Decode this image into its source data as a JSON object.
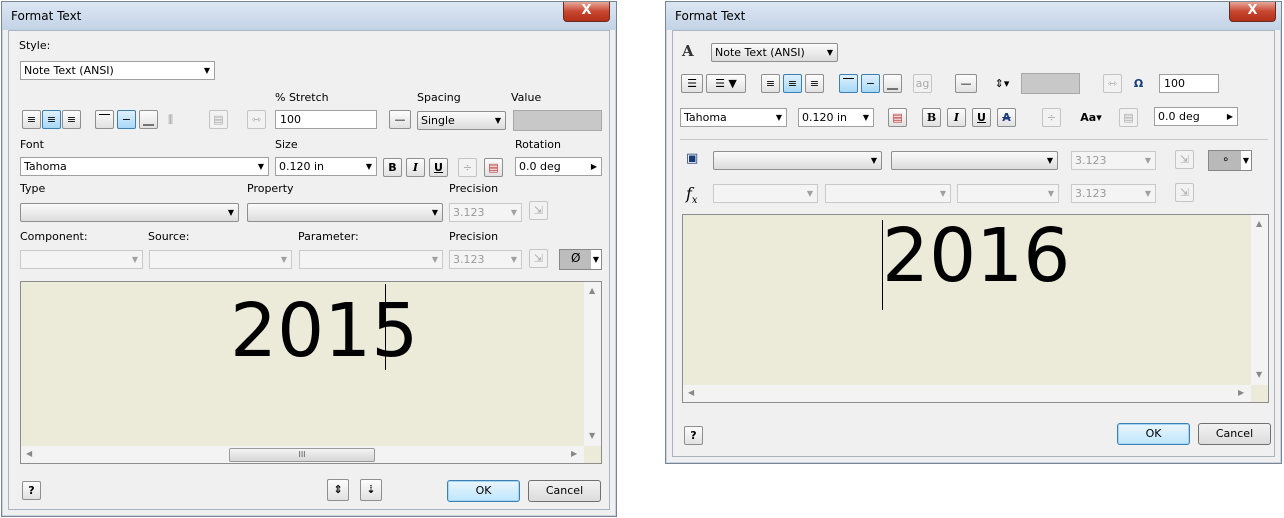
{
  "left_dialog": {
    "title": "Format Text",
    "close_glyph": "X",
    "style_label": "Style:",
    "style_value": "Note Text (ANSI)",
    "stretch_label": "% Stretch",
    "stretch_value": "100",
    "spacing_label": "Spacing",
    "spacing_value": "Single",
    "value_label": "Value",
    "font_label": "Font",
    "font_value": "Tahoma",
    "size_label": "Size",
    "size_value": "0.120 in",
    "rotation_label": "Rotation",
    "rotation_value": "0.0 deg",
    "bold": "B",
    "italic": "I",
    "underline": "U",
    "type_label": "Type",
    "property_label": "Property",
    "precision_label": "Precision",
    "precision_value": "3.123",
    "component_label": "Component:",
    "source_label": "Source:",
    "parameter_label": "Parameter:",
    "precision2_label": "Precision",
    "precision2_value": "3.123",
    "symbol_value": "Ø",
    "editor_text": "2015",
    "hscroll_grip": "III",
    "ok_label": "OK",
    "cancel_label": "Cancel",
    "help_glyph": "?"
  },
  "right_dialog": {
    "title": "Format Text",
    "close_glyph": "X",
    "style_value": "Note Text (ANSI)",
    "stretch_value": "100",
    "font_value": "Tahoma",
    "size_value": "0.120 in",
    "rotation_value": "0.0 deg",
    "bold": "B",
    "italic": "I",
    "underline": "U",
    "strike": "A",
    "precision_value": "3.123",
    "precision2_value": "3.123",
    "symbol_value": "∘",
    "fx_label": "f",
    "editor_text": "2016",
    "ok_label": "OK",
    "cancel_label": "Cancel",
    "help_glyph": "?"
  }
}
